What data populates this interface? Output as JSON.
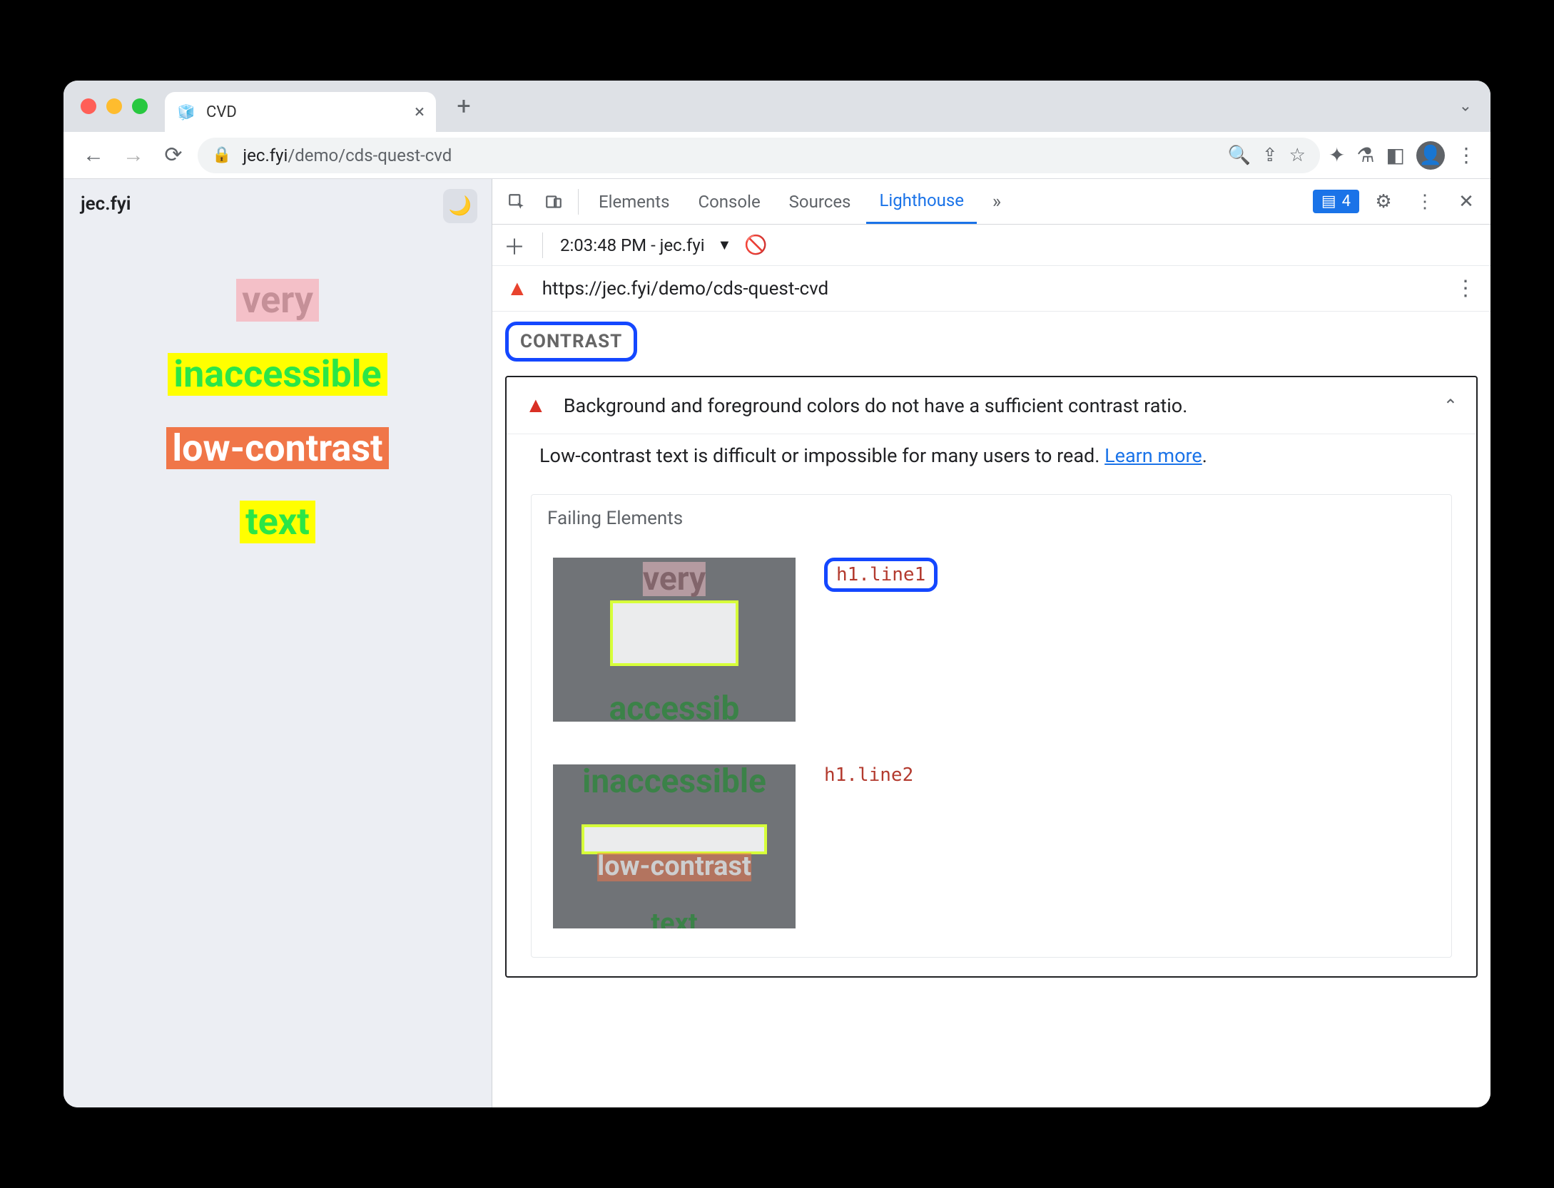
{
  "browser": {
    "tab_title": "CVD",
    "url_host": "jec.fyi",
    "url_path": "/demo/cds-quest-cvd"
  },
  "page": {
    "site_name": "jec.fyi",
    "lines": {
      "l1": "very",
      "l2": "inaccessible",
      "l3": "low-contrast",
      "l4": "text"
    }
  },
  "devtools": {
    "tabs": {
      "elements": "Elements",
      "console": "Console",
      "sources": "Sources",
      "lighthouse": "Lighthouse"
    },
    "issues_count": "4",
    "subbar": {
      "run_label": "2:03:48 PM - jec.fyi"
    },
    "lighthouse": {
      "url": "https://jec.fyi/demo/cds-quest-cvd",
      "section_label": "CONTRAST",
      "audit_title": "Background and foreground colors do not have a sufficient contrast ratio.",
      "audit_desc": "Low-contrast text is difficult or impossible for many users to read. ",
      "learn_more": "Learn more",
      "failing_title": "Failing Elements",
      "failing": [
        {
          "selector": "h1.line1"
        },
        {
          "selector": "h1.line2"
        }
      ]
    }
  }
}
